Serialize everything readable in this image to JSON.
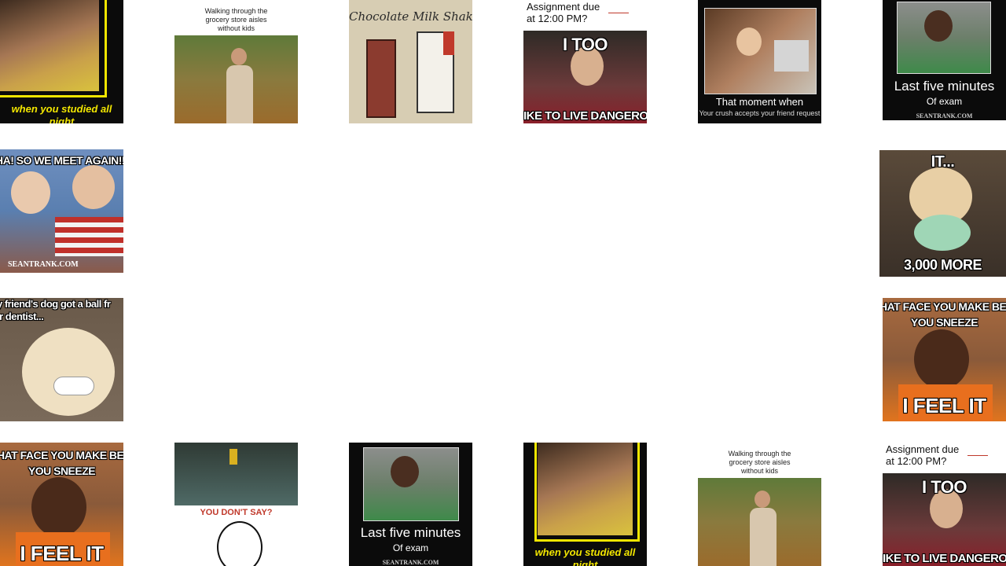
{
  "tiles": {
    "studied_1": {
      "caption": "when you studied all night"
    },
    "grocery_1": {
      "caption": "Walking through the grocery store aisles without kids"
    },
    "milkshake": {
      "caption": "Chocolate Milk Shake"
    },
    "assignment_1": {
      "top": "Assignment due at 12:00 PM?",
      "middle": "I TOO",
      "bottom": "IKE TO LIVE DANGEROUSL"
    },
    "crush": {
      "caption": "That moment when",
      "sub": "Your crush accepts your friend request"
    },
    "lastfive_1": {
      "caption": "Last five minutes",
      "sub": "Of exam",
      "credit": "SEANTRANK.COM"
    },
    "babies": {
      "caption": "HA! SO WE MEET AGAIN!!",
      "credit": "SEANTRANK.COM"
    },
    "dog_it": {
      "top": "IT...",
      "bottom": "3,000 MORE"
    },
    "dog_dentist": {
      "caption": "y friend's dog got a ball fr",
      "caption2": "ir dentist..."
    },
    "sneeze_1": {
      "top": "HAT FACE YOU MAKE BEFO",
      "top2": "YOU SNEEZE",
      "bottom": "I FEEL IT"
    },
    "sneeze_2": {
      "top": "HAT FACE YOU MAKE BEFO",
      "top2": "YOU SNEEZE",
      "bottom": "I FEEL IT"
    },
    "dontsay": {
      "caption": "YOU DON'T SAY?"
    },
    "lastfive_2": {
      "caption": "Last five minutes",
      "sub": "Of exam",
      "credit": "SEANTRANK.COM"
    },
    "studied_2": {
      "caption": "when you studied all night"
    },
    "grocery_2": {
      "caption": "Walking through the grocery store aisles without kids"
    },
    "assignment_2": {
      "top": "Assignment due at 12:00 PM?",
      "middle": "I TOO",
      "bottom": "IKE TO LIVE DANGEROUSL"
    }
  }
}
